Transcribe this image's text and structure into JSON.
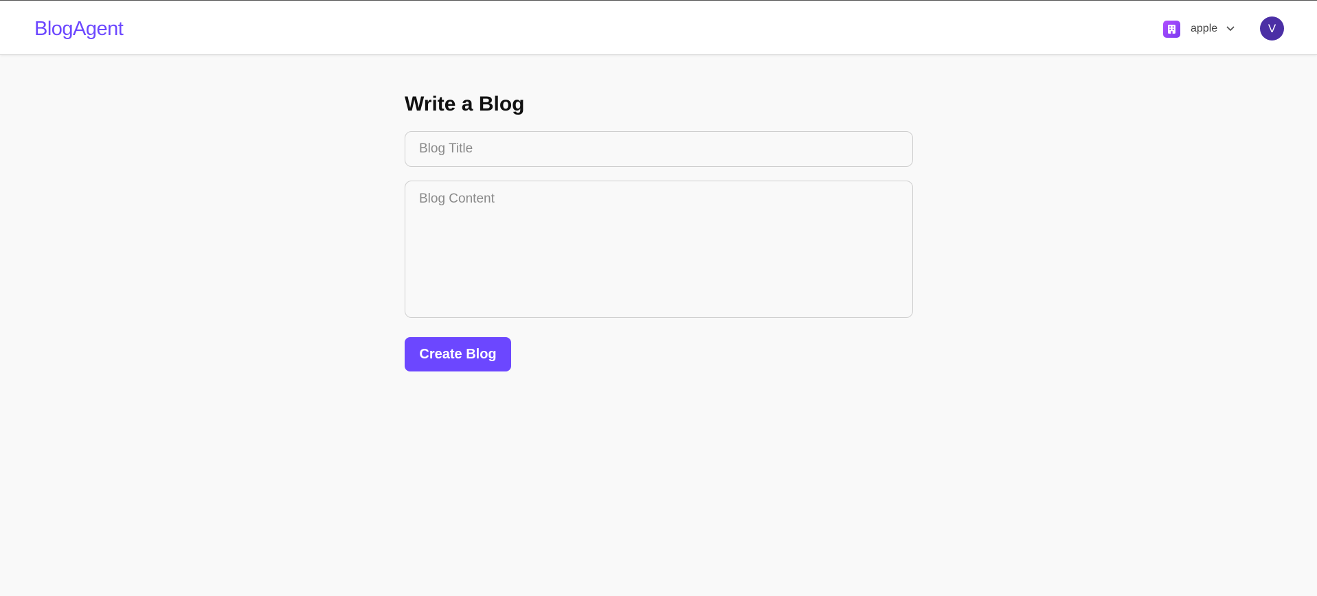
{
  "header": {
    "logo": "BlogAgent",
    "org_switcher": {
      "icon": "building-icon",
      "name": "apple",
      "chevron_icon": "chevron-down-icon"
    },
    "user_avatar": {
      "initial": "V",
      "color": "#4b2fa5"
    }
  },
  "main": {
    "title": "Write a Blog",
    "title_input": {
      "placeholder": "Blog Title",
      "value": ""
    },
    "content_input": {
      "placeholder": "Blog Content",
      "value": ""
    },
    "create_button_label": "Create Blog"
  },
  "colors": {
    "accent": "#6c47ff",
    "background": "#f9f9f9",
    "header_background": "#ffffff"
  }
}
